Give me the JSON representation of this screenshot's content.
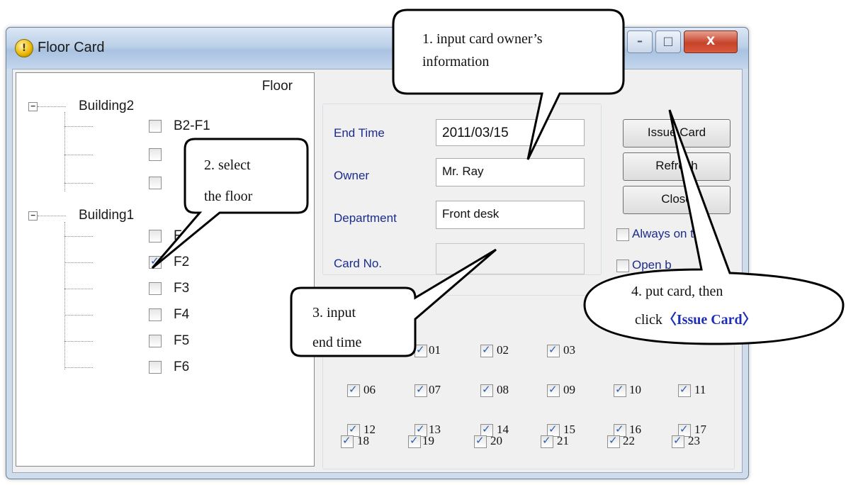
{
  "window": {
    "title": "Floor Card",
    "minimize": "–",
    "maximize": "□",
    "close": "X"
  },
  "tree": {
    "header": "Floor",
    "buildings": [
      {
        "name": "Building2",
        "floors": [
          {
            "label": "B2-F1",
            "checked": false
          },
          {
            "label": "",
            "checked": false
          },
          {
            "label": "",
            "checked": false
          }
        ]
      },
      {
        "name": "Building1",
        "floors": [
          {
            "label": "F1",
            "checked": false
          },
          {
            "label": "F2",
            "checked": true
          },
          {
            "label": "F3",
            "checked": false
          },
          {
            "label": "F4",
            "checked": false
          },
          {
            "label": "F5",
            "checked": false
          },
          {
            "label": "F6",
            "checked": false
          }
        ]
      }
    ]
  },
  "form": {
    "end_time_label": "End Time",
    "end_time_value": "2011/03/15",
    "owner_label": "Owner",
    "owner_value": "Mr. Ray",
    "department_label": "Department",
    "department_value": "Front desk",
    "card_no_label": "Card No.",
    "card_no_value": ""
  },
  "buttons": {
    "issue_card": "Issue Card",
    "refresh": "Refresh",
    "close": "Close"
  },
  "options": {
    "always_on_top": "Always on top",
    "open_b": "Open b"
  },
  "hours": [
    {
      "label": "01",
      "checked": true
    },
    {
      "label": "02",
      "checked": true
    },
    {
      "label": "03",
      "checked": true
    },
    {
      "label": "06",
      "checked": true
    },
    {
      "label": "07",
      "checked": true
    },
    {
      "label": "08",
      "checked": true
    },
    {
      "label": "09",
      "checked": true
    },
    {
      "label": "10",
      "checked": true
    },
    {
      "label": "11",
      "checked": true
    },
    {
      "label": "12",
      "checked": true
    },
    {
      "label": "13",
      "checked": true
    },
    {
      "label": "14",
      "checked": true
    },
    {
      "label": "15",
      "checked": true
    },
    {
      "label": "16",
      "checked": true
    },
    {
      "label": "17",
      "checked": true
    },
    {
      "label": "18",
      "checked": true
    },
    {
      "label": "19",
      "checked": true
    },
    {
      "label": "20",
      "checked": true
    },
    {
      "label": "21",
      "checked": true
    },
    {
      "label": "22",
      "checked": true
    },
    {
      "label": "23",
      "checked": true
    }
  ],
  "callouts": {
    "c1_line1": "1. input card owner’s",
    "c1_line2": "information",
    "c2_line1": "2. select",
    "c2_line2": "the floor",
    "c3_line1": "3. input",
    "c3_line2": "end time",
    "c4_line1": "4. put card, then",
    "c4_prefix": "click",
    "c4_bold": "〈Issue Card〉"
  }
}
